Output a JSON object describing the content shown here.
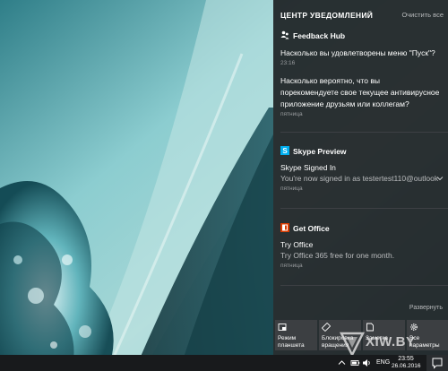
{
  "action_center": {
    "title": "ЦЕНТР УВЕДОМЛЕНИЙ",
    "clear_all": "Очистить все",
    "expand": "Развернуть",
    "groups": [
      {
        "app": "Feedback Hub",
        "icon": "people-icon",
        "notifications": [
          {
            "title": "Насколько вы удовлетворены меню \"Пуск\"?",
            "time": "23:16"
          },
          {
            "lines": [
              "Насколько вероятно, что вы",
              "порекомендуете свое текущее антивирусное",
              "приложение друзьям или коллегам?"
            ],
            "time": "пятница"
          }
        ]
      },
      {
        "app": "Skype Preview",
        "icon": "skype-icon",
        "notifications": [
          {
            "title": "Skype Signed In",
            "body": "You're now signed in as testertest110@outlook",
            "time": "пятница"
          }
        ]
      },
      {
        "app": "Get Office",
        "icon": "office-icon",
        "notifications": [
          {
            "title": "Try Office",
            "body": "Try Office 365 free for one month.",
            "time": "пятница"
          }
        ]
      }
    ],
    "quick_actions": [
      {
        "label": "Режим\nпланшета",
        "icon": "tablet-mode-icon"
      },
      {
        "label": "Блокировка\nвращения",
        "icon": "rotation-lock-icon"
      },
      {
        "label": "Заметка",
        "icon": "note-icon"
      },
      {
        "label": "Все\nпараметры",
        "icon": "settings-gear-icon"
      }
    ]
  },
  "taskbar": {
    "language": "ENG",
    "time": "23:55",
    "date": "26.06.2016"
  },
  "watermark": "XIW.BY",
  "colors": {
    "panel_bg": "#202326",
    "skype_blue": "#00aff0",
    "office_red": "#d83b01",
    "wallpaper_teal": "#7ec3c8"
  }
}
